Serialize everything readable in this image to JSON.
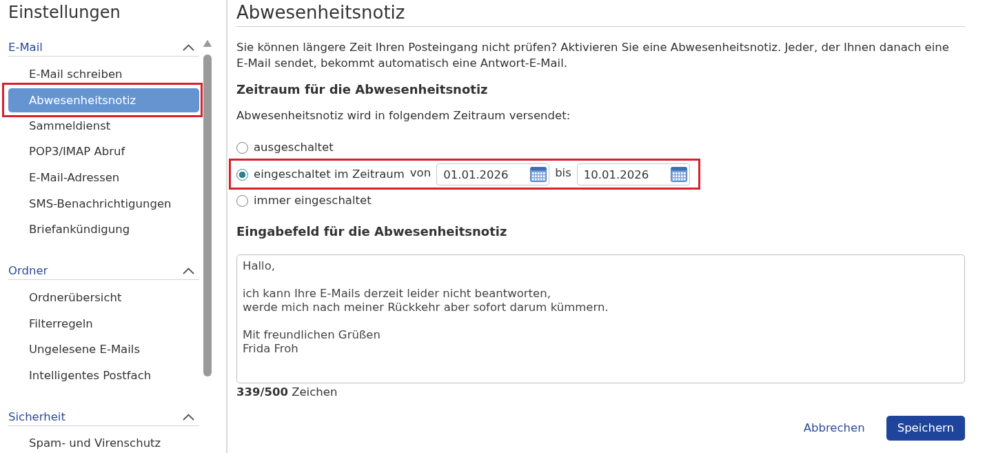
{
  "sidebar": {
    "title": "Einstellungen",
    "sections": [
      {
        "title": "E-Mail",
        "expanded": true,
        "items": [
          {
            "label": "E-Mail schreiben",
            "selected": false,
            "highlighted": false
          },
          {
            "label": "Abwesenheitsnotiz",
            "selected": true,
            "highlighted": true
          },
          {
            "label": "Sammeldienst",
            "selected": false,
            "highlighted": false
          },
          {
            "label": "POP3/IMAP Abruf",
            "selected": false,
            "highlighted": false
          },
          {
            "label": "E-Mail-Adressen",
            "selected": false,
            "highlighted": false
          },
          {
            "label": "SMS-Benachrichtigungen",
            "selected": false,
            "highlighted": false
          },
          {
            "label": "Briefankündigung",
            "selected": false,
            "highlighted": false
          }
        ]
      },
      {
        "title": "Ordner",
        "expanded": true,
        "items": [
          {
            "label": "Ordnerübersicht",
            "selected": false,
            "highlighted": false
          },
          {
            "label": "Filterregeln",
            "selected": false,
            "highlighted": false
          },
          {
            "label": "Ungelesene E-Mails",
            "selected": false,
            "highlighted": false
          },
          {
            "label": "Intelligentes Postfach",
            "selected": false,
            "highlighted": false
          }
        ]
      },
      {
        "title": "Sicherheit",
        "expanded": true,
        "items": [
          {
            "label": "Spam- und Virenschutz",
            "selected": false,
            "highlighted": false
          }
        ]
      }
    ]
  },
  "page": {
    "title": "Abwesenheitsnotiz",
    "intro": "Sie können längere Zeit Ihren Posteingang nicht prüfen? Aktivieren Sie eine Abwesenheitsnotiz. Jeder, der Ihnen danach eine E-Mail sendet, bekommt automatisch eine Antwort-E-Mail.",
    "period": {
      "heading": "Zeitraum für die Abwesenheitsnotiz",
      "caption": "Abwesenheitsnotiz wird in folgendem Zeitraum versendet:",
      "options": [
        {
          "kind": "plain",
          "label": "ausgeschaltet",
          "selected": false,
          "highlighted": false
        },
        {
          "kind": "range",
          "label": "eingeschaltet im Zeitraum",
          "selected": true,
          "highlighted": true,
          "from_label": "von",
          "from_value": "01.01.2026",
          "to_label": "bis",
          "to_value": "10.01.2026"
        },
        {
          "kind": "plain",
          "label": "immer eingeschaltet",
          "selected": false,
          "highlighted": false
        }
      ]
    },
    "message": {
      "heading": "Eingabefeld für die Abwesenheitsnotiz",
      "value": "Hallo,\n\nich kann Ihre E-Mails derzeit leider nicht beantworten,\nwerde mich nach meiner Rückkehr aber sofort darum kümmern.\n\nMit freundlichen Grüßen\nFrida Froh",
      "counter": "**339/500** Zeichen"
    },
    "buttons": [
      {
        "kind": "link",
        "label": "Abbrechen"
      },
      {
        "kind": "primary",
        "label": "Speichern"
      }
    ]
  }
}
